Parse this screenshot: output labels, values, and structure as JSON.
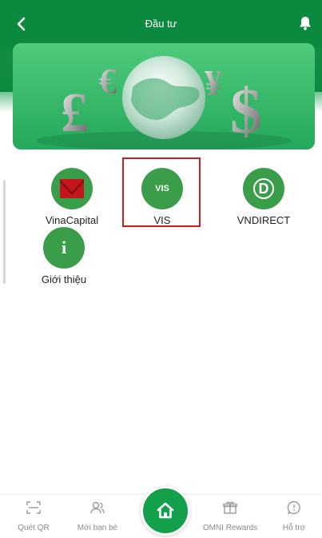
{
  "header": {
    "title": "Đầu tư"
  },
  "tiles": [
    {
      "label": "VinaCapital",
      "icon": "vinacapital-logo-icon"
    },
    {
      "label": "VIS",
      "icon_text": "VIS"
    },
    {
      "label": "VNDIRECT",
      "icon_text": "D"
    },
    {
      "label": "Giới thiệu",
      "icon_text": "i"
    }
  ],
  "bottom_nav": [
    {
      "label": "Quét QR",
      "icon": "qr-scan-icon"
    },
    {
      "label": "Mời bạn bè",
      "icon": "invite-friends-icon"
    },
    {
      "label": "",
      "icon": "home-icon"
    },
    {
      "label": "OMNI Rewards",
      "icon": "gift-icon"
    },
    {
      "label": "Hỗ trợ",
      "icon": "support-chat-icon"
    }
  ],
  "colors": {
    "brand_green": "#0b8a3f",
    "tile_green": "#3a9d4a",
    "highlight_red": "#d11a1a"
  }
}
